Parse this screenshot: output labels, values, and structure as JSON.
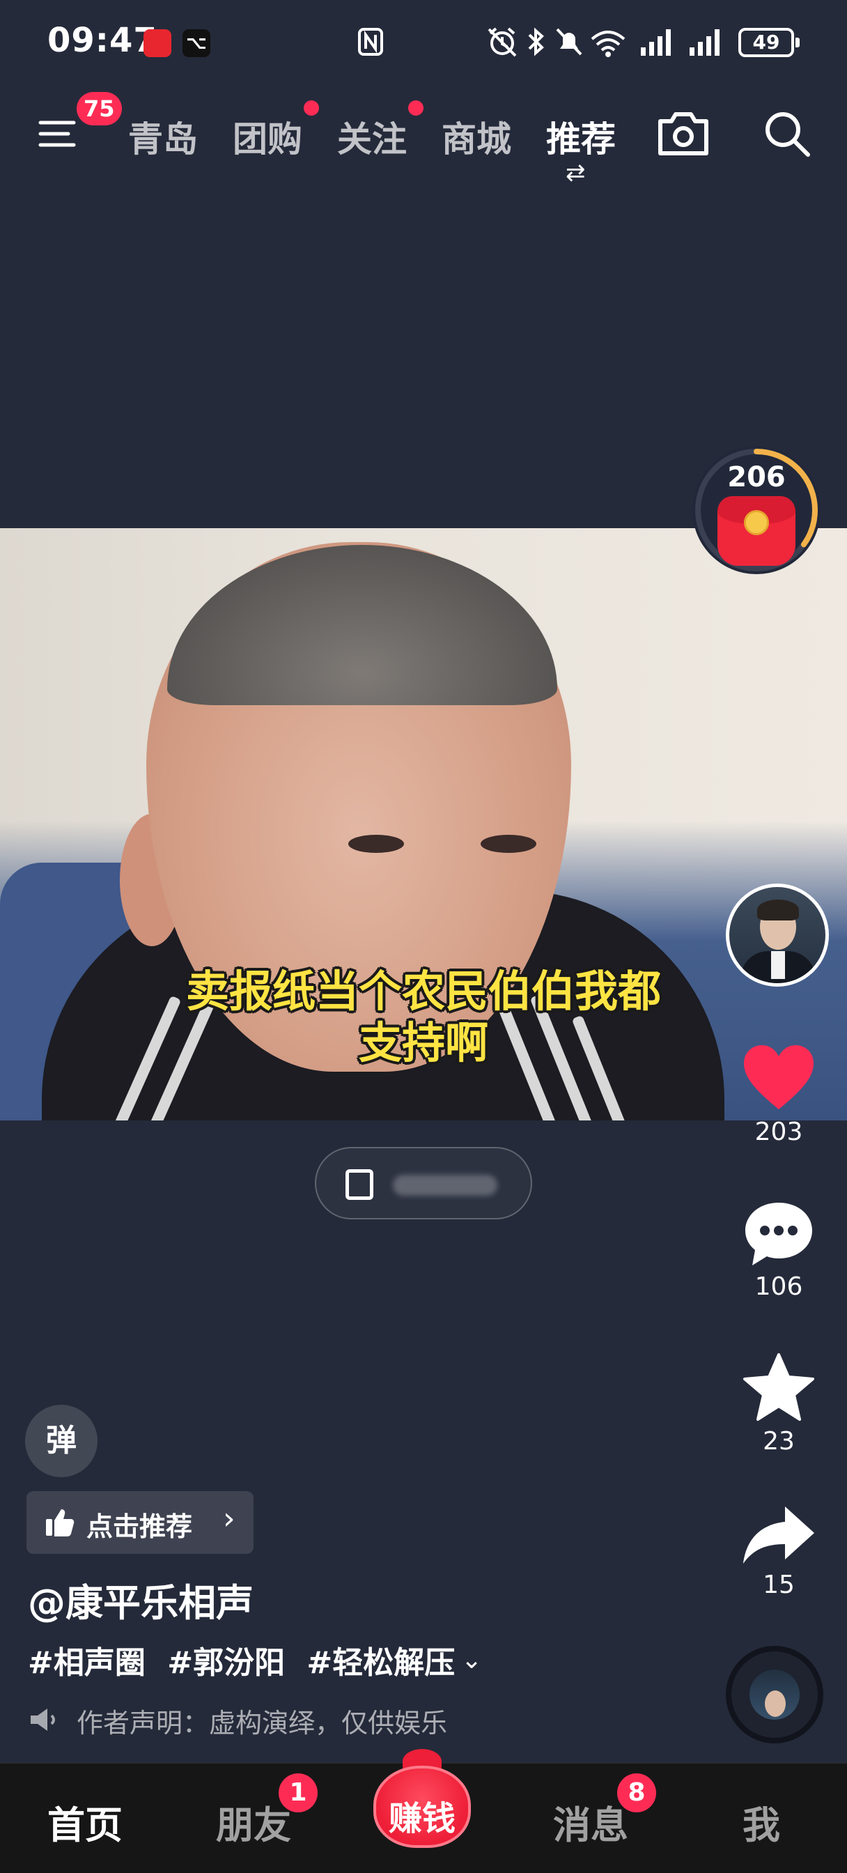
{
  "status_bar": {
    "time": "09:47",
    "battery": "49",
    "capcut_glyph": "⌥"
  },
  "top_nav": {
    "menu_badge": "75",
    "tabs": [
      {
        "label": "青岛",
        "active": false,
        "dot": false
      },
      {
        "label": "团购",
        "active": false,
        "dot": true
      },
      {
        "label": "关注",
        "active": false,
        "dot": true
      },
      {
        "label": "商城",
        "active": false,
        "dot": false
      },
      {
        "label": "推荐",
        "active": true,
        "dot": false
      }
    ],
    "switch_glyph": "⇄"
  },
  "video": {
    "subtitle_line1": "卖报纸当个农民伯伯我都",
    "subtitle_line2": "支持啊"
  },
  "redpacket": {
    "count": "206",
    "progress": 0.35
  },
  "actions": {
    "like_count": "203",
    "comment_count": "106",
    "favorite_count": "23",
    "share_count": "15"
  },
  "info": {
    "danmu_label": "弹",
    "recommend_label": "点击推荐",
    "recommend_chevron": "›",
    "author": "@康平乐相声",
    "tags": [
      "#相声圈",
      "#郭汾阳",
      "#轻松解压"
    ],
    "tags_chevron": "⌄",
    "disclaimer": "作者声明：虚构演绎，仅供娱乐"
  },
  "tab_bar": {
    "home": "首页",
    "friends": "朋友",
    "friends_badge": "1",
    "earn": "赚钱",
    "messages": "消息",
    "messages_badge": "8",
    "me": "我"
  },
  "colors": {
    "background": "#252a3a",
    "accent_red": "#fe2c55",
    "subtitle_yellow": "#ffe443"
  }
}
